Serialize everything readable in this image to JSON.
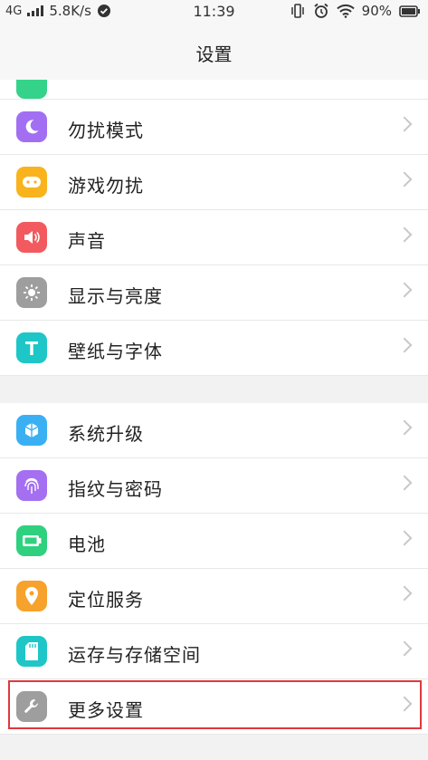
{
  "status_bar": {
    "network": "4G",
    "speed": "5.8K/s",
    "time": "11:39",
    "battery": "90%"
  },
  "header": {
    "title": "设置"
  },
  "group1": {
    "items": [
      {
        "label": "勿扰模式",
        "icon": "moon-icon",
        "color": "#a36ff2"
      },
      {
        "label": "游戏勿扰",
        "icon": "gamepad-icon",
        "color": "#f9b31c"
      },
      {
        "label": "声音",
        "icon": "speaker-icon",
        "color": "#f25a5f"
      },
      {
        "label": "显示与亮度",
        "icon": "sun-icon",
        "color": "#9e9e9e"
      },
      {
        "label": "壁纸与字体",
        "icon": "font-t-icon",
        "color": "#1ec6c7"
      }
    ]
  },
  "group2": {
    "items": [
      {
        "label": "系统升级",
        "icon": "upgrade-cube-icon",
        "color": "#3ab0f3"
      },
      {
        "label": "指纹与密码",
        "icon": "fingerprint-icon",
        "color": "#a46ff1"
      },
      {
        "label": "电池",
        "icon": "battery-icon",
        "color": "#2fd17f"
      },
      {
        "label": "定位服务",
        "icon": "location-pin-icon",
        "color": "#f6a22c"
      },
      {
        "label": "运存与存储空间",
        "icon": "sd-card-icon",
        "color": "#1ec6c7"
      },
      {
        "label": "更多设置",
        "icon": "wrench-icon",
        "color": "#9e9e9e"
      }
    ]
  }
}
